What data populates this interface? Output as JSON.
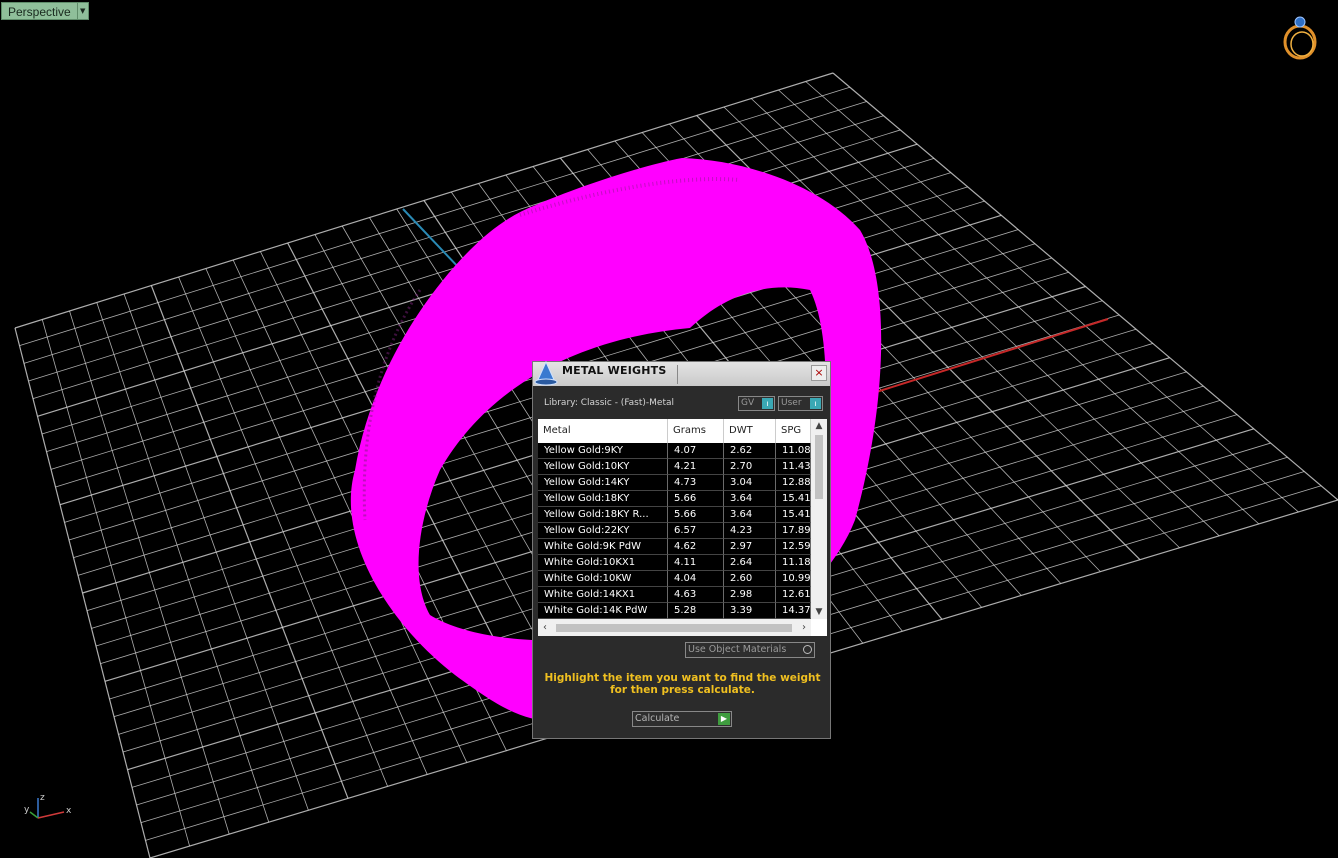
{
  "viewport": {
    "label": "Perspective",
    "background": "#000000",
    "grid_color": "#d8d8d8",
    "model_color": "#ff00ff",
    "axis_x_color": "#c62828",
    "axis_z_color": "#2a8ab5",
    "axis_icon_labels": {
      "z": "z",
      "y": "y",
      "x": "x"
    },
    "corner_icon": "ring-icon"
  },
  "dialog": {
    "title": "METAL WEIGHTS",
    "close_icon": "×",
    "library_label": "Library: Classic - (Fast)-Metal",
    "toggle_gv": "GV",
    "toggle_user": "User",
    "table": {
      "headers": [
        "Metal",
        "Grams",
        "DWT",
        "SPG"
      ],
      "rows": [
        [
          "Yellow Gold:9KY",
          "4.07",
          "2.62",
          "11.08"
        ],
        [
          "Yellow Gold:10KY",
          "4.21",
          "2.70",
          "11.43"
        ],
        [
          "Yellow Gold:14KY",
          "4.73",
          "3.04",
          "12.88"
        ],
        [
          "Yellow Gold:18KY",
          "5.66",
          "3.64",
          "15.41"
        ],
        [
          "Yellow Gold:18KY R...",
          "5.66",
          "3.64",
          "15.41"
        ],
        [
          "Yellow Gold:22KY",
          "6.57",
          "4.23",
          "17.89"
        ],
        [
          "White Gold:9K PdW",
          "4.62",
          "2.97",
          "12.59"
        ],
        [
          "White Gold:10KX1",
          "4.11",
          "2.64",
          "11.18"
        ],
        [
          "White Gold:10KW",
          "4.04",
          "2.60",
          "10.99"
        ],
        [
          "White Gold:14KX1",
          "4.63",
          "2.98",
          "12.61"
        ],
        [
          "White Gold:14K PdW",
          "5.28",
          "3.39",
          "14.37"
        ]
      ]
    },
    "use_object_materials": "Use Object Materials",
    "hint": "Highlight the item you want to find the weight for then press calculate.",
    "calculate": "Calculate"
  }
}
